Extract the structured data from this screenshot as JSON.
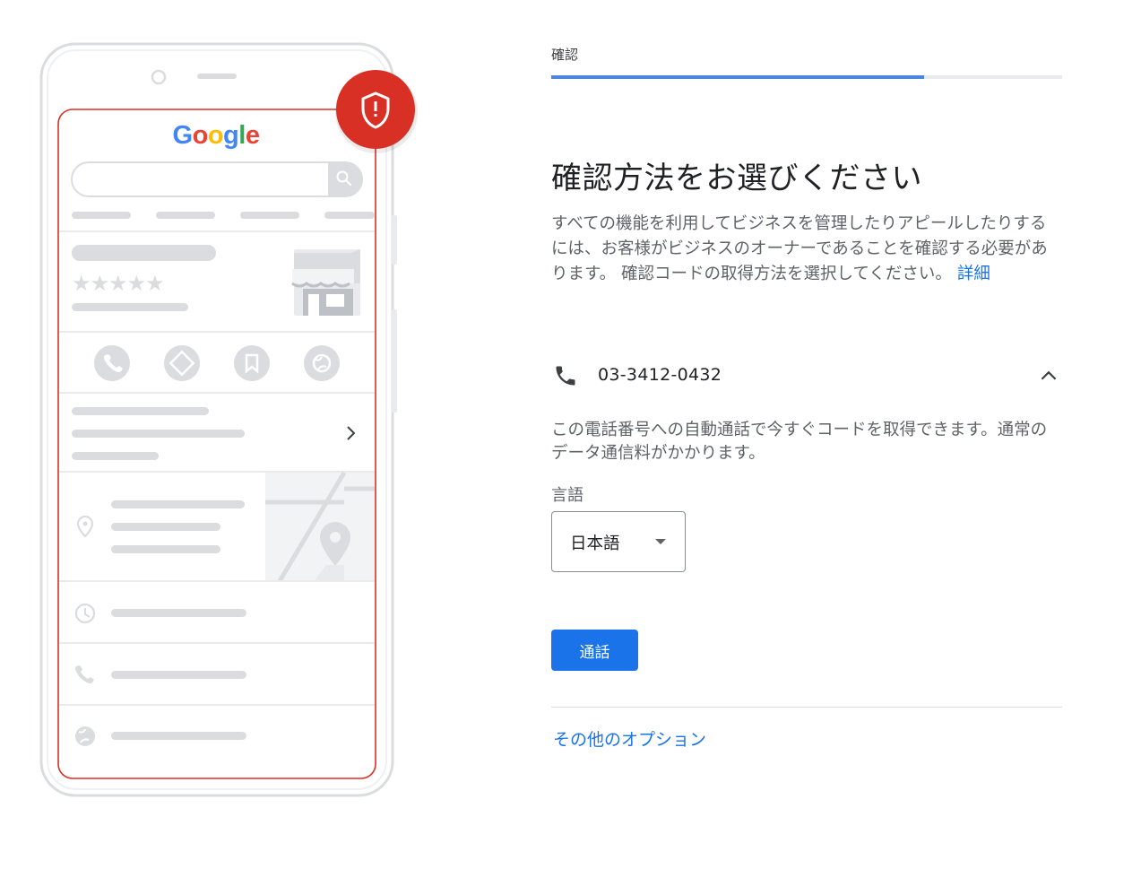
{
  "illustration": {
    "brand_logo": "Google",
    "accent_red": "#d93025",
    "line_gray": "#dadce0"
  },
  "verification": {
    "step_label": "確認",
    "progress_fraction": 0.73,
    "title": "確認方法をお選びください",
    "description": "すべての機能を利用してビジネスを管理したりアピールしたりするには、お客様がビジネスのオーナーであることを確認する必要があります。 確認コードの取得方法を選択してください。",
    "learn_more": "詳細",
    "phone_number": "03-3412-0432",
    "call_description": "この電話番号への自動通話で今すぐコードを取得できます。通常のデータ通信料がかかります。",
    "language_label": "言語",
    "language_value": "日本語",
    "call_button": "通話",
    "other_options": "その他のオプション",
    "accent_blue": "#1a73e8"
  }
}
